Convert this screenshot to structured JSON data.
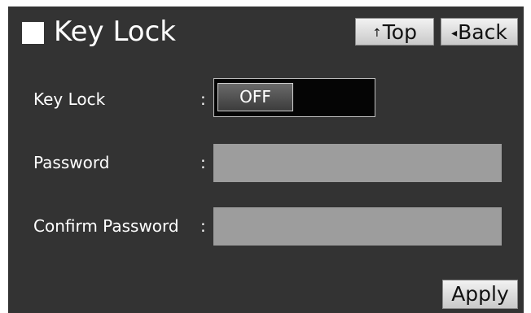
{
  "header": {
    "title": "Key Lock",
    "top_button": {
      "icon": "up-arrow-icon",
      "glyph": "↑",
      "label": "Top"
    },
    "back_button": {
      "icon": "left-triangle-icon",
      "glyph": "◂",
      "label": "Back"
    }
  },
  "form": {
    "key_lock": {
      "label": "Key Lock",
      "colon": ":",
      "state": "OFF"
    },
    "password": {
      "label": "Password",
      "colon": ":",
      "value": ""
    },
    "confirm_password": {
      "label": "Confirm Password",
      "colon": ":",
      "value": ""
    }
  },
  "footer": {
    "apply_label": "Apply"
  },
  "colors": {
    "background": "#333333",
    "field": "#9d9d9d",
    "toggle_track": "#050505",
    "button": "#dcdcdc"
  }
}
